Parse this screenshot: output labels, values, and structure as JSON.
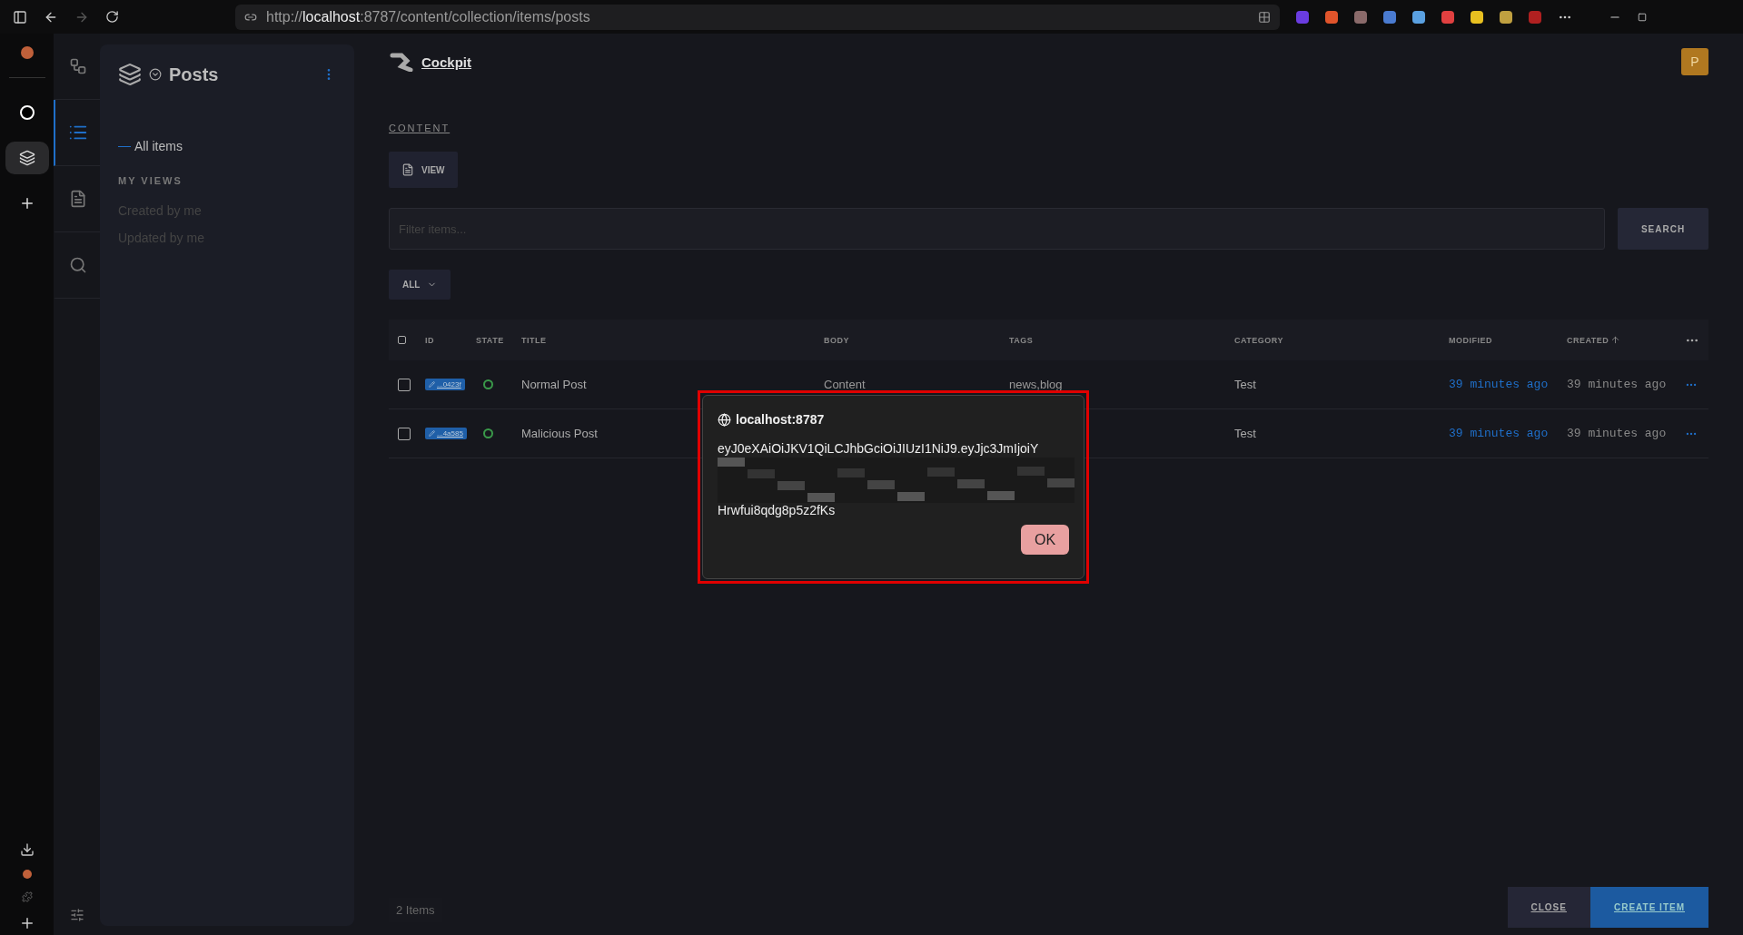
{
  "browser": {
    "scheme": "http://",
    "host": "localhost",
    "rest": ":8787/content/collection/items/posts",
    "extensions": [
      {
        "color": "#6a3ce0"
      },
      {
        "color": "#e0542b"
      },
      {
        "color": "#8a6a6a"
      },
      {
        "color": "#4a7bd0"
      },
      {
        "color": "#5aa0e0"
      },
      {
        "color": "#e04040"
      },
      {
        "color": "#e8c020"
      },
      {
        "color": "#c0a040"
      },
      {
        "color": "#b02020"
      }
    ]
  },
  "app_rail": [
    {
      "kind": "logo",
      "selected": false
    },
    {
      "kind": "layers",
      "selected": true
    },
    {
      "kind": "add",
      "selected": false
    }
  ],
  "tool_rail": [
    {
      "kind": "grid",
      "selected": false
    },
    {
      "kind": "list",
      "selected": true
    },
    {
      "kind": "file",
      "selected": false
    },
    {
      "kind": "search",
      "selected": false
    }
  ],
  "sidebar": {
    "title": "Posts",
    "nav": [
      {
        "label": "All items",
        "selected": true
      }
    ],
    "section": "MY VIEWS",
    "views": [
      {
        "label": "Created by me"
      },
      {
        "label": "Updated by me"
      }
    ]
  },
  "header": {
    "brand": "Cockpit",
    "avatar": "P"
  },
  "breadcrumb": "CONTENT",
  "view_button": "VIEW",
  "search": {
    "placeholder": "Filter items...",
    "button": "SEARCH"
  },
  "filter": "ALL",
  "table": {
    "all_checked": false,
    "columns": [
      {
        "label": "ID",
        "sorted_ascending": false
      },
      {
        "label": "STATE",
        "sorted_ascending": false
      },
      {
        "label": "TITLE",
        "sorted_ascending": false
      },
      {
        "label": "BODY",
        "sorted_ascending": false
      },
      {
        "label": "TAGS",
        "sorted_ascending": false
      },
      {
        "label": "CATEGORY",
        "sorted_ascending": false
      },
      {
        "label": "MODIFIED",
        "sorted_ascending": false
      },
      {
        "label": "CREATED",
        "sorted_ascending": true
      }
    ],
    "rows": [
      {
        "checked": false,
        "id": "...0423f",
        "published": true,
        "title": "Normal Post",
        "body": "Content",
        "tags": "news,blog",
        "category": "Test",
        "modified": "39 minutes ago",
        "created": "39 minutes ago"
      },
      {
        "checked": false,
        "id": "...4a585",
        "published": true,
        "title": "Malicious Post",
        "category": "Test",
        "modified": "39 minutes ago",
        "created": "39 minutes ago"
      }
    ]
  },
  "footer": {
    "count": "2 Items",
    "buttons": [
      {
        "label": "CLOSE",
        "kind": "secondary"
      },
      {
        "label": "CREATE ITEM",
        "kind": "primary"
      }
    ]
  },
  "alert": {
    "origin": "localhost:8787",
    "message_start": "eyJ0eXAiOiJKV1QiLCJhbGciOiJIUzI1NiJ9.eyJjc3JmIjoiY",
    "message_end": "Hrwfui8qdg8p5z2fKs",
    "button": "OK"
  }
}
